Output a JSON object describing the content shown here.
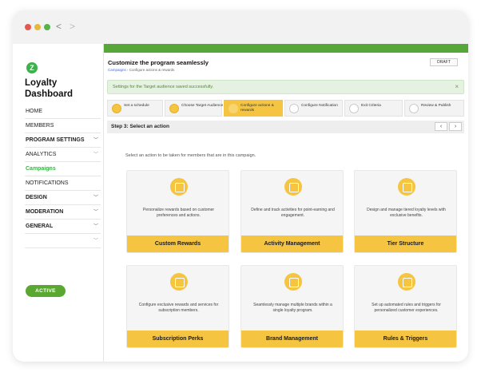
{
  "window": {
    "back_glyph": "<",
    "forward_glyph": ">"
  },
  "sidebar": {
    "logo_letter": "Z",
    "brand_line1": "Loyalty",
    "brand_line2": "Dashboard",
    "items": [
      {
        "label": "HOME",
        "style": "normal",
        "chevron": false
      },
      {
        "label": "MEMBERS",
        "style": "normal",
        "chevron": false
      },
      {
        "label": "PROGRAM SETTINGS",
        "style": "bold",
        "chevron": true
      },
      {
        "label": "ANALYTICS",
        "style": "normal",
        "chevron": true
      },
      {
        "label": "Campaigns",
        "style": "active",
        "chevron": false
      },
      {
        "label": "NOTIFICATIONS",
        "style": "normal",
        "chevron": false
      },
      {
        "label": "DESIGN",
        "style": "bold",
        "chevron": true
      },
      {
        "label": "MODERATION",
        "style": "bold",
        "chevron": true
      },
      {
        "label": "GENERAL",
        "style": "bold",
        "chevron": true
      },
      {
        "label": "",
        "style": "normal",
        "chevron": true
      }
    ],
    "status_pill": "ACTIVE"
  },
  "header": {
    "title": "Customize the program seamlessly",
    "breadcrumb_link": "Campaigns",
    "breadcrumb_sep": "›",
    "breadcrumb_current": "Configure actions & rewards",
    "draft_label": "DRAFT"
  },
  "alert": {
    "message": "Settings for the Target audience saved successfully.",
    "close": "×"
  },
  "stepper": [
    {
      "label": "Set a schedule",
      "state": "done"
    },
    {
      "label": "Choose Target Audience",
      "state": "done"
    },
    {
      "label": "Configure actions & rewards",
      "state": "current"
    },
    {
      "label": "Configure Notification",
      "state": "pending"
    },
    {
      "label": "Exit Criteria",
      "state": "pending"
    },
    {
      "label": "Review & Publish",
      "state": "pending"
    }
  ],
  "step_header": {
    "title": "Step 3: Select an action",
    "prev": "‹",
    "next": "›"
  },
  "instruction": "Select an action to be taken for members that are in this campaign.",
  "cards": [
    {
      "icon": "rewards-icon",
      "desc": "Personalize rewards based on customer preferences and actions.",
      "button": "Custom Rewards"
    },
    {
      "icon": "activity-icon",
      "desc": "Define and track activities for point-earning and engagement.",
      "button": "Activity Management"
    },
    {
      "icon": "tier-icon",
      "desc": "Design and manage tiered loyalty levels with exclusive benefits.",
      "button": "Tier Structure"
    },
    {
      "icon": "subscription-icon",
      "desc": "Configure exclusive rewards and services for subscription members.",
      "button": "Subscription Perks"
    },
    {
      "icon": "brand-icon",
      "desc": "Seamlessly manage multiple brands within a single loyalty program.",
      "button": "Brand Management"
    },
    {
      "icon": "rules-icon",
      "desc": "Set up automated rules and triggers for personalized customer experiences.",
      "button": "Rules & Triggers"
    }
  ],
  "colors": {
    "accent_green": "#57a63a",
    "accent_yellow": "#f5c542",
    "active_nav": "#3bb34a"
  }
}
